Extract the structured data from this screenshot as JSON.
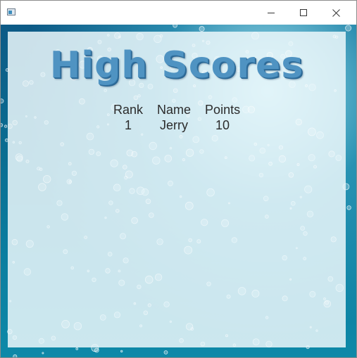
{
  "window": {
    "icon": "app-window-icon",
    "controls": [
      "minimize-icon",
      "maximize-icon",
      "close-icon"
    ]
  },
  "title": "High Scores",
  "table": {
    "headers": {
      "rank": "Rank",
      "name": "Name",
      "points": "Points"
    },
    "rows": [
      {
        "rank": "1",
        "name": "Jerry",
        "points": "10"
      }
    ]
  },
  "colors": {
    "title": "#4f93c2",
    "text": "#2b2b2b",
    "water": "#0b6e92"
  }
}
